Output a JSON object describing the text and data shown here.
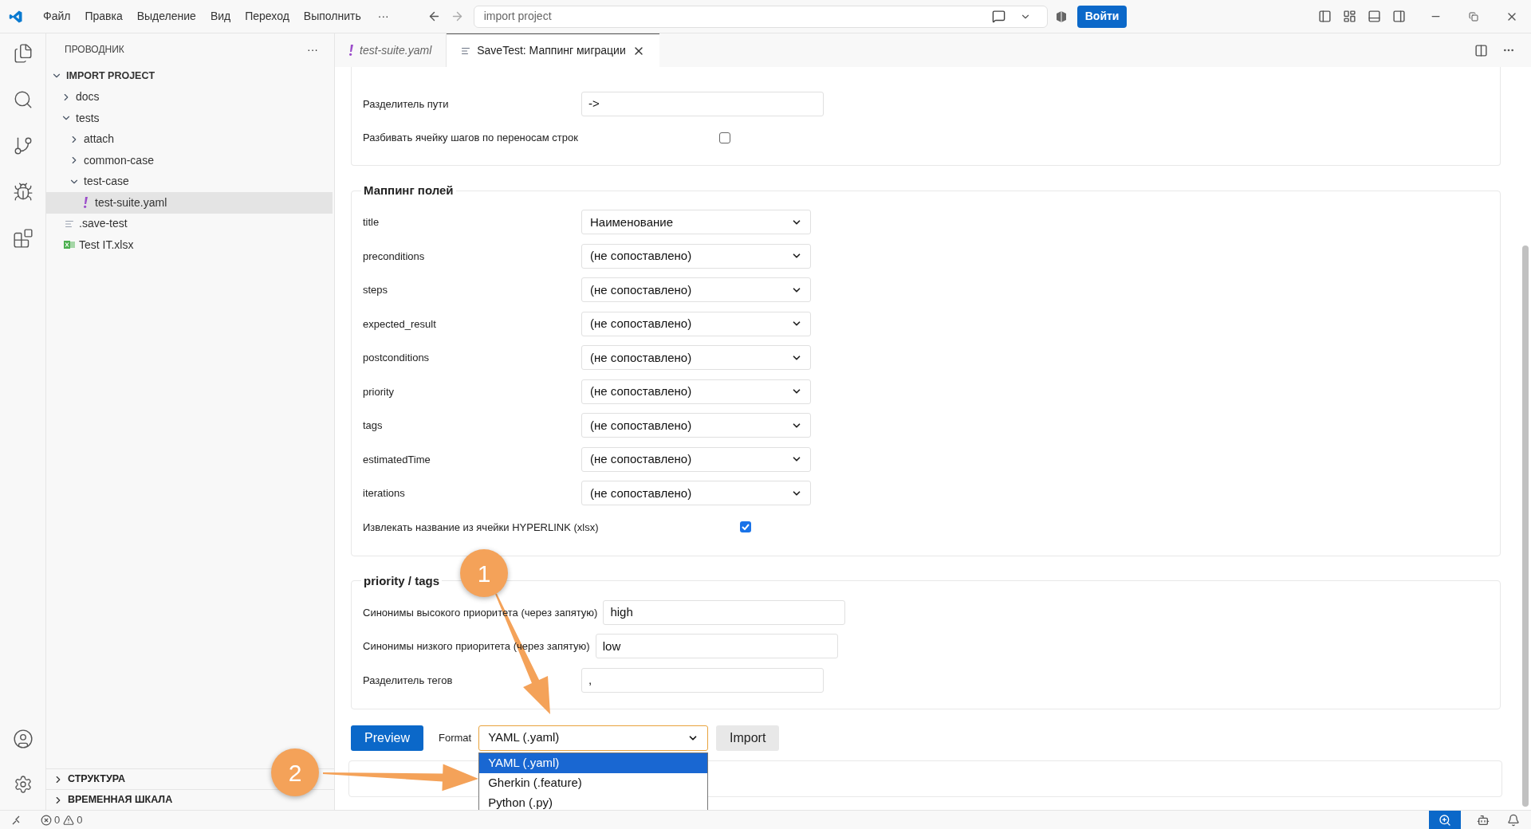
{
  "title_bar": {
    "menu": [
      "Файл",
      "Правка",
      "Выделение",
      "Вид",
      "Переход",
      "Выполнить"
    ],
    "more": "···",
    "search": {
      "value": "import project"
    },
    "signin": "Войти"
  },
  "sidebar": {
    "title": "ПРОВОДНИК",
    "more": "···",
    "tree": [
      {
        "label": "IMPORT PROJECT",
        "kind": "root",
        "expanded": true,
        "selected": false,
        "children": [
          {
            "label": "docs",
            "kind": "folder",
            "expanded": false,
            "selected": false
          },
          {
            "label": "tests",
            "kind": "folder",
            "expanded": true,
            "selected": false,
            "children": [
              {
                "label": "attach",
                "kind": "folder",
                "expanded": false,
                "selected": false
              },
              {
                "label": "common-case",
                "kind": "folder",
                "expanded": false,
                "selected": false
              },
              {
                "label": "test-case",
                "kind": "folder",
                "expanded": true,
                "selected": false,
                "children": [
                  {
                    "label": "test-suite.yaml",
                    "kind": "yaml",
                    "selected": true
                  }
                ]
              }
            ]
          },
          {
            "label": ".save-test",
            "kind": "text",
            "selected": false
          },
          {
            "label": "Test IT.xlsx",
            "kind": "excel",
            "selected": false
          }
        ]
      }
    ],
    "sections": [
      {
        "label": "СТРУКТУРА",
        "expanded": false
      },
      {
        "label": "ВРЕМЕННАЯ ШКАЛА",
        "expanded": false
      }
    ]
  },
  "tabs": [
    {
      "label": "test-suite.yaml",
      "kind": "yaml",
      "selected": false
    },
    {
      "label": "SaveTest: Маппинг миграции",
      "kind": "doc",
      "selected": true
    }
  ],
  "form": {
    "general": {
      "rows": [
        {
          "kind": "text",
          "label": "Разделитель пути",
          "value": "->"
        },
        {
          "kind": "checkbox",
          "label": "Разбивать ячейку шагов по переносам строк",
          "checked": false
        }
      ]
    },
    "mapping": {
      "title": "Маппинг полей",
      "rows": [
        {
          "kind": "select",
          "label": "title",
          "value": "Наименование"
        },
        {
          "kind": "select",
          "label": "preconditions",
          "value": "(не сопоставлено)"
        },
        {
          "kind": "select",
          "label": "steps",
          "value": "(не сопоставлено)"
        },
        {
          "kind": "select",
          "label": "expected_result",
          "value": "(не сопоставлено)"
        },
        {
          "kind": "select",
          "label": "postconditions",
          "value": "(не сопоставлено)"
        },
        {
          "kind": "select",
          "label": "priority",
          "value": "(не сопоставлено)"
        },
        {
          "kind": "select",
          "label": "tags",
          "value": "(не сопоставлено)"
        },
        {
          "kind": "select",
          "label": "estimatedTime",
          "value": "(не сопоставлено)"
        },
        {
          "kind": "select",
          "label": "iterations",
          "value": "(не сопоставлено)"
        },
        {
          "kind": "checkbox",
          "label": "Извлекать название из ячейки HYPERLINK (xlsx)",
          "checked": true
        }
      ]
    },
    "priority": {
      "title": "priority / tags",
      "rows": [
        {
          "kind": "text",
          "label": "Синонимы высокого приоритета (через запятую)",
          "value": "high"
        },
        {
          "kind": "text",
          "label": "Синонимы низкого приоритета (через запятую)",
          "value": "low"
        },
        {
          "kind": "text",
          "label": "Разделитель тегов",
          "value": ","
        }
      ]
    }
  },
  "actions": {
    "preview": "Preview",
    "format_label": "Format",
    "format": {
      "value": "YAML (.yaml)",
      "expanded": true,
      "options": [
        {
          "label": "YAML (.yaml)",
          "selected": true
        },
        {
          "label": "Gherkin (.feature)",
          "selected": false
        },
        {
          "label": "Python (.py)",
          "selected": false
        }
      ]
    },
    "import": "Import"
  },
  "annotations": [
    {
      "label": "1"
    },
    {
      "label": "2"
    }
  ],
  "status_bar": {
    "errors": "0",
    "warnings": "0"
  }
}
